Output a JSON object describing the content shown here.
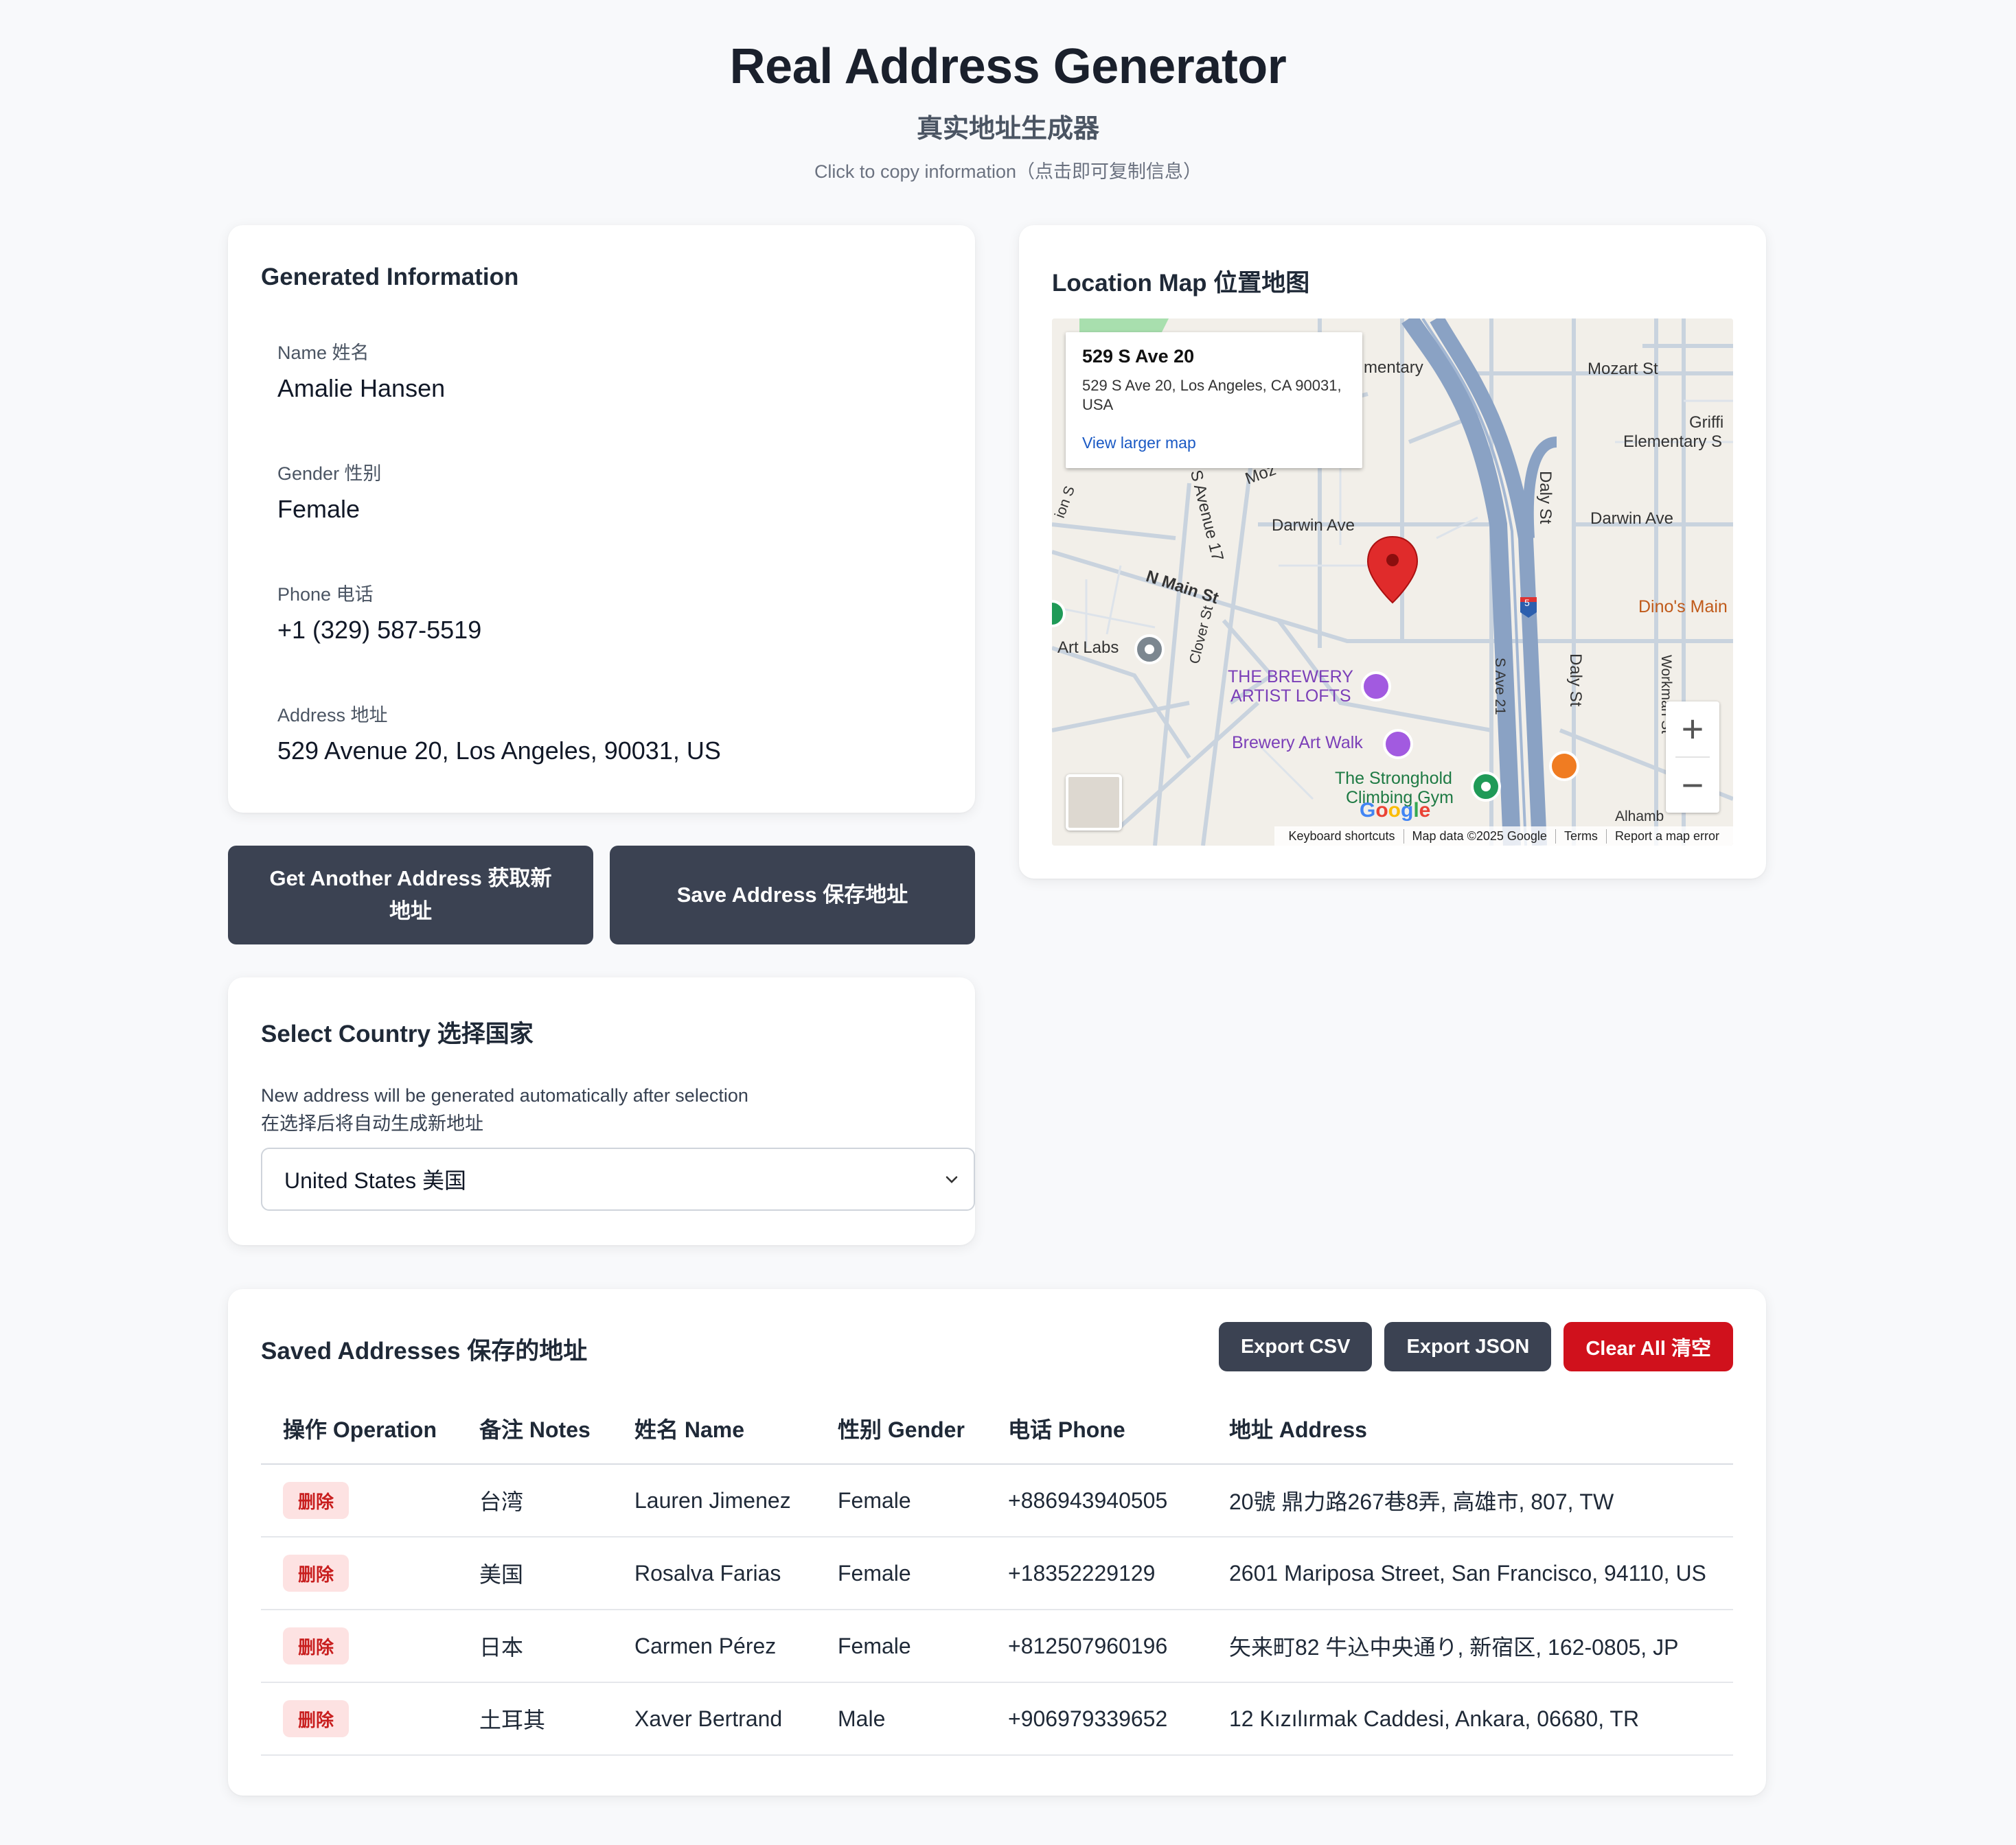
{
  "header": {
    "title": "Real Address Generator",
    "subtitle": "真实地址生成器",
    "hint": "Click to copy information（点击即可复制信息）"
  },
  "info": {
    "title": "Generated Information",
    "fields": [
      {
        "label": "Name 姓名",
        "value": "Amalie Hansen"
      },
      {
        "label": "Gender 性别",
        "value": "Female"
      },
      {
        "label": "Phone 电话",
        "value": "+1 (329) 587-5519"
      },
      {
        "label": "Address 地址",
        "value": "529 Avenue 20, Los Angeles, 90031, US"
      }
    ]
  },
  "actions": {
    "another_label": "Get Another Address 获取新地址",
    "save_label": "Save Address 保存地址"
  },
  "country": {
    "title": "Select Country 选择国家",
    "desc_line1": "New address will be generated automatically after selection",
    "desc_line2": "在选择后将自动生成新地址",
    "selected": "United States 美国"
  },
  "map": {
    "title": "Location Map 位置地图",
    "popup_title": "529 S Ave 20",
    "popup_address": "529 S Ave 20, Los Angeles, CA 90031, USA",
    "popup_link": "View larger map",
    "labels": {
      "elementary": "mentary",
      "mozart": "Mozart St",
      "griffin1": "Griffi",
      "griffin2": "Elementary S",
      "darwin_left": "Darwin Ave",
      "darwin_right": "Darwin Ave",
      "daly1": "Daly St",
      "daly2": "Daly St",
      "n_main": "N Main St",
      "s_avenue17": "S Avenue 17",
      "moz": "Moz",
      "clover": "Clover St",
      "s_ave21": "S Ave 21",
      "art_labs": "Art Labs",
      "brewery1": "THE BREWERY",
      "brewery2": "ARTIST LOFTS",
      "brewery_walk": "Brewery Art Walk",
      "stronghold1": "The Stronghold",
      "stronghold2": "Climbing Gym",
      "dinos": "Dino's Main",
      "workman": "Workman St",
      "alhambra": "Alhamb",
      "highway": "5",
      "mion": "ion S"
    },
    "zoom_in": "+",
    "zoom_out": "−",
    "footer": [
      "Keyboard shortcuts",
      "Map data ©2025 Google",
      "Terms",
      "Report a map error"
    ],
    "google_letters": [
      "G",
      "o",
      "o",
      "g",
      "l",
      "e"
    ]
  },
  "saved": {
    "title": "Saved Addresses 保存的地址",
    "export_csv": "Export CSV",
    "export_json": "Export JSON",
    "clear_all": "Clear All 清空",
    "columns": [
      "操作 Operation",
      "备注 Notes",
      "姓名 Name",
      "性别 Gender",
      "电话 Phone",
      "地址 Address"
    ],
    "delete_label": "删除",
    "rows": [
      {
        "notes": "台湾",
        "name": "Lauren Jimenez",
        "gender": "Female",
        "phone": "+886943940505",
        "address": "20號 鼎力路267巷8弄, 高雄市, 807, TW"
      },
      {
        "notes": "美国",
        "name": "Rosalva Farias",
        "gender": "Female",
        "phone": "+18352229129",
        "address": "2601 Mariposa Street, San Francisco, 94110, US"
      },
      {
        "notes": "日本",
        "name": "Carmen Pérez",
        "gender": "Female",
        "phone": "+812507960196",
        "address": "矢来町82 牛込中央通り, 新宿区, 162-0805, JP"
      },
      {
        "notes": "土耳其",
        "name": "Xaver Bertrand",
        "gender": "Male",
        "phone": "+906979339652",
        "address": "12 Kızılırmak Caddesi, Ankara, 06680, TR"
      }
    ]
  }
}
